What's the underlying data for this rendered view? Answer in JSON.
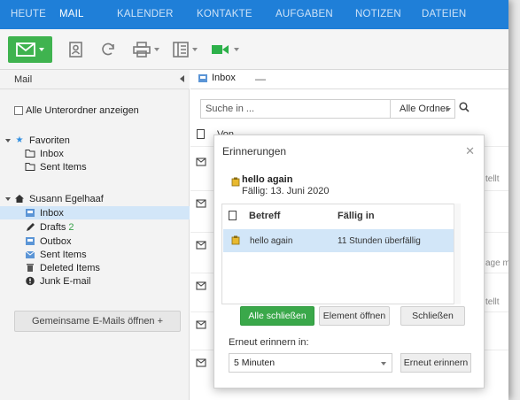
{
  "topnav": {
    "items": [
      "HEUTE",
      "MAIL",
      "KALENDER",
      "KONTAKTE",
      "AUFGABEN",
      "NOTIZEN",
      "DATEIEN"
    ],
    "active": "MAIL"
  },
  "toolbar": {
    "icons": [
      "new-mail-icon",
      "contacts-icon",
      "refresh-icon",
      "print-icon",
      "layout-icon",
      "video-icon"
    ]
  },
  "leftpane": {
    "title": "Mail",
    "show_subfolders_label": "Alle Unterordner anzeigen",
    "favorites": {
      "label": "Favoriten",
      "items": [
        "Inbox",
        "Sent Items"
      ]
    },
    "account": {
      "label": "Susann Egelhaaf",
      "items": [
        {
          "label": "Inbox",
          "icon": "inbox-icon",
          "count": ""
        },
        {
          "label": "Drafts",
          "icon": "pencil-icon",
          "count": "2"
        },
        {
          "label": "Outbox",
          "icon": "outbox-icon",
          "count": ""
        },
        {
          "label": "Sent Items",
          "icon": "sent-icon",
          "count": ""
        },
        {
          "label": "Deleted Items",
          "icon": "trash-icon",
          "count": ""
        },
        {
          "label": "Junk E-mail",
          "icon": "junk-icon",
          "count": ""
        }
      ]
    },
    "shared_button_label": "Gemeinsame E-Mails öffnen +"
  },
  "tabs": [
    {
      "label": "Inbox"
    }
  ],
  "search": {
    "placeholder": "Suche in ...",
    "folder_scope": "Alle Ordner"
  },
  "list_header": {
    "from": "Von"
  },
  "list_snippets": [
    "tellt",
    "age mit",
    "tellt"
  ],
  "dialog": {
    "title": "Erinnerungen",
    "item_subject": "hello again",
    "item_due": "Fällig: 13. Juni 2020",
    "table": {
      "columns": [
        "Betreff",
        "Fällig in"
      ],
      "rows": [
        {
          "subject": "hello again",
          "due": "11 Stunden überfällig"
        }
      ]
    },
    "buttons": {
      "close_all": "Alle schließen",
      "open_item": "Element öffnen",
      "close": "Schließen"
    },
    "snooze_label": "Erneut erinnern in:",
    "snooze_value": "5 Minuten",
    "snooze_button": "Erneut erinnern"
  }
}
